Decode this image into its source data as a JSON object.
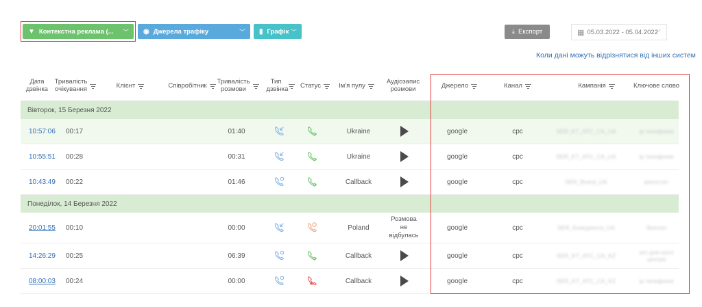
{
  "toolbar": {
    "campaign_filter": "Контекстна реклама (...",
    "sources_filter": "Джерела трафіку",
    "chart_button": "Графік",
    "export_button": "Експорт",
    "date_range": "05.03.2022 - 05.04.2022",
    "note": "Коли дані можуть відрізнятися від інших систем",
    "accent_green": "#6dc26d",
    "accent_blue": "#5aa9dc",
    "accent_teal": "#47c2c8",
    "highlight_red": "#e03b3b"
  },
  "columns": {
    "date": "Дата дзвінка",
    "wait": "Тривалість очікування",
    "client": "Клієнт",
    "employee": "Співробітник",
    "talk": "Тривалість розмови",
    "type": "Тип дзвінка",
    "status": "Статус",
    "pool": "Ім'я пулу",
    "audio": "Аудіозапис розмови",
    "source": "Джерело",
    "channel": "Канал",
    "campaign": "Кампанія",
    "keyword": "Ключове слово"
  },
  "groups": [
    {
      "label": "Вівторок, 15 Березня 2022",
      "rows": [
        {
          "time": "10:57:06",
          "wait": "00:17",
          "talk": "01:40",
          "type_icon": "incoming-call-icon",
          "status_icon": "answered-call-icon",
          "pool": "Ukraine",
          "audio": "play",
          "source": "google",
          "channel": "cpc",
          "campaign": "SER_KT_ATC_CA_UA",
          "keyword": "ip телефонія"
        },
        {
          "time": "10:55:51",
          "wait": "00:28",
          "talk": "00:31",
          "type_icon": "incoming-call-icon",
          "status_icon": "answered-call-icon",
          "pool": "Ukraine",
          "audio": "play",
          "source": "google",
          "channel": "cpc",
          "campaign": "SER_KT_ATC_CA_UA",
          "keyword": "ip телефонія"
        },
        {
          "time": "10:43:49",
          "wait": "00:22",
          "talk": "01:46",
          "type_icon": "callback-icon",
          "status_icon": "answered-call-icon",
          "pool": "Callback",
          "audio": "play",
          "source": "google",
          "channel": "cpc",
          "campaign": "SER_Brand_UA",
          "keyword": "рінгостат"
        }
      ]
    },
    {
      "label": "Понеділок, 14 Березня 2022",
      "rows": [
        {
          "time": "20:01:55",
          "wait": "00:10",
          "talk": "00:00",
          "type_icon": "incoming-call-icon",
          "status_icon": "missed-call-icon",
          "pool": "Poland",
          "audio": "Розмова не відбулась",
          "source": "google",
          "channel": "cpc",
          "campaign": "SER_Конкуренти_UA",
          "keyword": "бінотел"
        },
        {
          "time": "14:26:29",
          "wait": "00:25",
          "talk": "06:39",
          "type_icon": "callback-icon",
          "status_icon": "answered-call-icon",
          "pool": "Callback",
          "audio": "play",
          "source": "google",
          "channel": "cpc",
          "campaign": "SER_KT_ATC_CA_KZ",
          "keyword": "атс для колл центра"
        },
        {
          "time": "08:00:03",
          "wait": "00:24",
          "talk": "00:00",
          "type_icon": "callback-icon",
          "status_icon": "not-reached-call-icon",
          "pool": "Callback",
          "audio": "play",
          "source": "google",
          "channel": "cpc",
          "campaign": "SER_KT_ATC_CA_KZ",
          "keyword": "ip телефонія"
        }
      ]
    }
  ]
}
